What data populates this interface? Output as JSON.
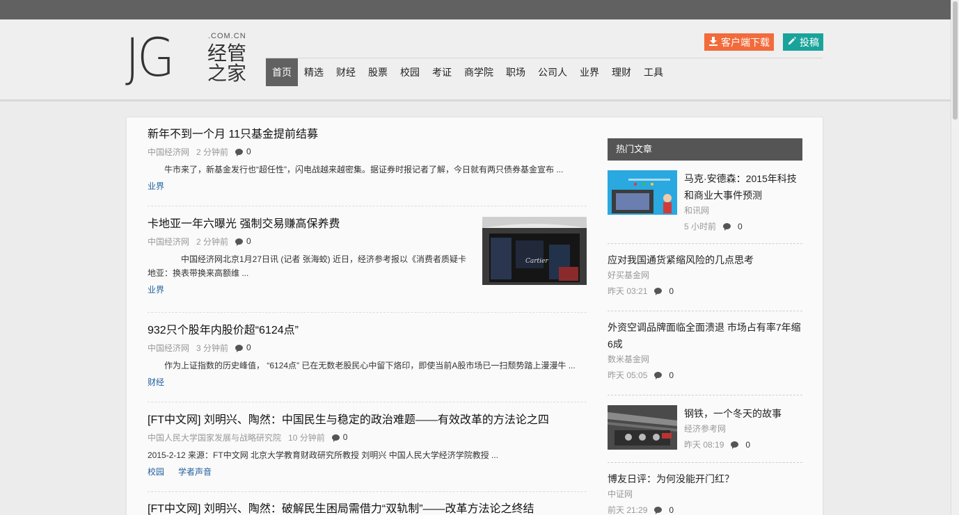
{
  "header": {
    "logo_letters": "JG",
    "logo_domain": ".COM.CN",
    "logo_cn": "经管之家",
    "download_label": "客户端下载",
    "submit_label": "投稿",
    "nav": [
      "首页",
      "精选",
      "财经",
      "股票",
      "校园",
      "考证",
      "商学院",
      "职场",
      "公司人",
      "业界",
      "理财",
      "工具"
    ],
    "active_nav": "首页"
  },
  "articles": [
    {
      "title": "新年不到一个月 11只基金提前结募",
      "source": "中国经济网",
      "time": "2 分钟前",
      "comments": "0",
      "summary": "牛市来了，新基金发行也“超任性”，闪电战越来越密集。据证券时报记者了解，今日就有两只债券基金宣布 ...",
      "tags": [
        "业界"
      ]
    },
    {
      "title": "卡地亚一年六曝光 强制交易赚高保养费",
      "source": "中国经济网",
      "time": "2 分钟前",
      "comments": "0",
      "summary": "中国经济网北京1月27日讯 (记者 张海蛟) 近日，经济参考报以《消费者质疑卡地亚：换表带换来高额维 ...",
      "tags": [
        "业界"
      ],
      "image_text": "Cartier"
    },
    {
      "title": "932只个股年内股价超“6124点”",
      "source": "中国经济网",
      "time": "3 分钟前",
      "comments": "0",
      "summary": "作为上证指数的历史峰值， “6124点” 已在无数老股民心中留下烙印，即使当前A股市场已一扫颓势踏上漫漫牛 ...",
      "tags": [
        "财经"
      ]
    },
    {
      "title": "[FT中文网] 刘明兴、陶然：中国民生与稳定的政治难题——有效改革的方法论之四",
      "source": "中国人民大学国家发展与战略研究院",
      "time": "10 分钟前",
      "comments": "0",
      "summary": "2015-2-12 来源：FT中文网 北京大学教育财政研究所教授 刘明兴 中国人民大学经济学院教授 ...",
      "tags": [
        "校园",
        "学者声音"
      ]
    },
    {
      "title": "[FT中文网] 刘明兴、陶然：破解民生困局需借力“双轨制”——改革方法论之终结",
      "source": "",
      "time": "",
      "comments": "",
      "summary": "",
      "tags": []
    }
  ],
  "hot": {
    "title": "热门文章",
    "items": [
      {
        "title": "马克·安德森：2015年科技和商业大事件预测",
        "source": "和讯网",
        "time": "5 小时前",
        "comments": "0",
        "has_image": true
      },
      {
        "title": "应对我国通货紧缩风险的几点思考",
        "source": "好买基金网",
        "time": "昨天 03:21",
        "comments": "0",
        "has_image": false
      },
      {
        "title": "外资空调品牌面临全面溃退 市场占有率7年缩6成",
        "source": "数米基金网",
        "time": "昨天 05:05",
        "comments": "0",
        "has_image": false
      },
      {
        "title": "钢铁，一个冬天的故事",
        "source": "经济参考网",
        "time": "昨天 08:19",
        "comments": "0",
        "has_image": true
      },
      {
        "title": "博友日评：为何没能开门红？",
        "source": "中证网",
        "time": "前天 21:29",
        "comments": "0",
        "has_image": false
      }
    ]
  },
  "colors": {
    "accent_download": "#f26b3a",
    "accent_submit": "#1aa39a",
    "nav_active": "#616161",
    "tag_link": "#1f5f9e"
  }
}
